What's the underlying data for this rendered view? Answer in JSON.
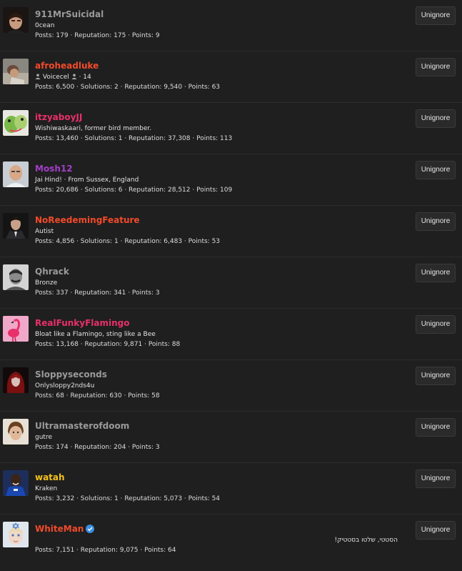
{
  "colors": {
    "background": "#1f1f1f",
    "button_bg": "#2a2a2a",
    "verified_badge": "#3b8fe0"
  },
  "unignore_label": "Unignore",
  "users": [
    {
      "name": "911MrSuicidal",
      "color": "#9a9a9a",
      "title": "0cean",
      "stats": "Posts: 179 · Reputation: 175 · Points: 9",
      "avatar": "dark-haired-man"
    },
    {
      "name": "afroheadluke",
      "color": "#f24a2a",
      "title_prefix": "Voicecel",
      "title_count": "· 14",
      "stats": "Posts: 6,500 · Solutions: 2 · Reputation: 9,540 · Points: 63",
      "avatar": "reclining-man"
    },
    {
      "name": "itzyaboyJJ",
      "color": "#e8306a",
      "title": "Wishiwaskaari, former bird member.",
      "stats": "Posts: 13,460 · Solutions: 1 · Reputation: 37,308 · Points: 113",
      "avatar": "green-frog"
    },
    {
      "name": "Mosh12",
      "color": "#a23ec8",
      "title": "Jai Hind! · From Sussex, England",
      "stats": "Posts: 20,686 · Solutions: 6 · Reputation: 28,512 · Points: 109",
      "avatar": "bald-man"
    },
    {
      "name": "NoReedemingFeature",
      "color": "#f24a2a",
      "title": "Autist",
      "stats": "Posts: 4,856 · Solutions: 1 · Reputation: 6,483 · Points: 53",
      "avatar": "suited-man"
    },
    {
      "name": "Qhrack",
      "color": "#9a9a9a",
      "title": "Bronze",
      "stats": "Posts: 337 · Reputation: 341 · Points: 3",
      "avatar": "mustached-man"
    },
    {
      "name": "RealFunkyFlamingo",
      "color": "#e8306a",
      "title": "Bloat like a Flamingo, sting like a Bee",
      "stats": "Posts: 13,168 · Reputation: 9,871 · Points: 88",
      "avatar": "pink-flamingo"
    },
    {
      "name": "Sloppyseconds",
      "color": "#9a9a9a",
      "title": "Onlysloppy2nds4u",
      "stats": "Posts: 68 · Reputation: 630 · Points: 58",
      "avatar": "red-haired-figure"
    },
    {
      "name": "Ultramasterofdoom",
      "color": "#9a9a9a",
      "title": "gutre",
      "stats": "Posts: 174 · Reputation: 204 · Points: 3",
      "avatar": "brown-haired-boy"
    },
    {
      "name": "watah",
      "color": "#f4c21c",
      "title": "Kraken",
      "stats": "Posts: 3,232 · Solutions: 1 · Reputation: 5,073 · Points: 54",
      "avatar": "soccer-player"
    },
    {
      "name": "WhiteMan",
      "color": "#f24a2a",
      "verified": true,
      "title": "הסטטי, שלטו בסטטיק!",
      "stats": "Posts: 7,151 · Reputation: 9,075 · Points: 64",
      "avatar": "white-face"
    }
  ]
}
